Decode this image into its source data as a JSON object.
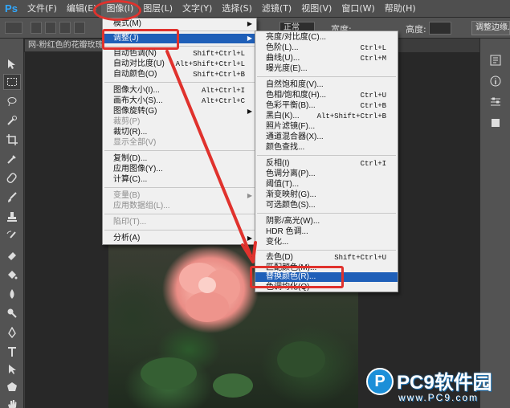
{
  "app": {
    "logo": "Ps",
    "menu": [
      {
        "label": "文件(F)"
      },
      {
        "label": "编辑(E)"
      },
      {
        "label": "图像(I)"
      },
      {
        "label": "图层(L)"
      },
      {
        "label": "文字(Y)"
      },
      {
        "label": "选择(S)"
      },
      {
        "label": "滤镜(T)"
      },
      {
        "label": "视图(V)"
      },
      {
        "label": "窗口(W)"
      },
      {
        "label": "帮助(H)"
      }
    ]
  },
  "options_bar": {
    "style_value": "正常",
    "width_label": "宽度:",
    "height_label": "高度:",
    "refine_button": "调整边缘..."
  },
  "document": {
    "tab_title": "网-粉红色的花瓣玫瑰"
  },
  "image_menu": {
    "items": [
      {
        "label": "模式(M)",
        "shortcut": "",
        "submenu": true,
        "disabled": false
      },
      {
        "label": "调整(J)",
        "shortcut": "",
        "submenu": true,
        "disabled": false
      },
      {
        "label": "自动色调(N)",
        "shortcut": "Shift+Ctrl+L",
        "submenu": false,
        "disabled": false
      },
      {
        "label": "自动对比度(U)",
        "shortcut": "Alt+Shift+Ctrl+L",
        "submenu": false,
        "disabled": false
      },
      {
        "label": "自动颜色(O)",
        "shortcut": "Shift+Ctrl+B",
        "submenu": false,
        "disabled": false
      },
      {
        "label": "图像大小(I)...",
        "shortcut": "Alt+Ctrl+I",
        "submenu": false,
        "disabled": false
      },
      {
        "label": "画布大小(S)...",
        "shortcut": "Alt+Ctrl+C",
        "submenu": false,
        "disabled": false
      },
      {
        "label": "图像旋转(G)",
        "shortcut": "",
        "submenu": true,
        "disabled": false
      },
      {
        "label": "裁剪(P)",
        "shortcut": "",
        "submenu": false,
        "disabled": true
      },
      {
        "label": "裁切(R)...",
        "shortcut": "",
        "submenu": false,
        "disabled": false
      },
      {
        "label": "显示全部(V)",
        "shortcut": "",
        "submenu": false,
        "disabled": true
      },
      {
        "label": "复制(D)...",
        "shortcut": "",
        "submenu": false,
        "disabled": false
      },
      {
        "label": "应用图像(Y)...",
        "shortcut": "",
        "submenu": false,
        "disabled": false
      },
      {
        "label": "计算(C)...",
        "shortcut": "",
        "submenu": false,
        "disabled": false
      },
      {
        "label": "变量(B)",
        "shortcut": "",
        "submenu": true,
        "disabled": true
      },
      {
        "label": "应用数据组(L)...",
        "shortcut": "",
        "submenu": false,
        "disabled": true
      },
      {
        "label": "陷印(T)...",
        "shortcut": "",
        "submenu": false,
        "disabled": true
      },
      {
        "label": "分析(A)",
        "shortcut": "",
        "submenu": true,
        "disabled": false
      }
    ]
  },
  "adjust_menu": {
    "items": [
      {
        "label": "亮度/对比度(C)...",
        "shortcut": ""
      },
      {
        "label": "色阶(L)...",
        "shortcut": "Ctrl+L"
      },
      {
        "label": "曲线(U)...",
        "shortcut": "Ctrl+M"
      },
      {
        "label": "曝光度(E)...",
        "shortcut": ""
      },
      {
        "label": "自然饱和度(V)...",
        "shortcut": ""
      },
      {
        "label": "色相/饱和度(H)...",
        "shortcut": "Ctrl+U"
      },
      {
        "label": "色彩平衡(B)...",
        "shortcut": "Ctrl+B"
      },
      {
        "label": "黑白(K)...",
        "shortcut": "Alt+Shift+Ctrl+B"
      },
      {
        "label": "照片滤镜(F)...",
        "shortcut": ""
      },
      {
        "label": "通道混合器(X)...",
        "shortcut": ""
      },
      {
        "label": "颜色查找...",
        "shortcut": ""
      },
      {
        "label": "反相(I)",
        "shortcut": "Ctrl+I"
      },
      {
        "label": "色调分离(P)...",
        "shortcut": ""
      },
      {
        "label": "阈值(T)...",
        "shortcut": ""
      },
      {
        "label": "渐变映射(G)...",
        "shortcut": ""
      },
      {
        "label": "可选颜色(S)...",
        "shortcut": ""
      },
      {
        "label": "阴影/高光(W)...",
        "shortcut": ""
      },
      {
        "label": "HDR 色调...",
        "shortcut": ""
      },
      {
        "label": "变化...",
        "shortcut": ""
      },
      {
        "label": "去色(D)",
        "shortcut": "Shift+Ctrl+U"
      },
      {
        "label": "匹配颜色(M)...",
        "shortcut": ""
      },
      {
        "label": "替换颜色(R)...",
        "shortcut": ""
      },
      {
        "label": "色调均化(Q)",
        "shortcut": ""
      }
    ]
  },
  "watermark": {
    "logo": "P",
    "title": "PC9软件园",
    "url": "www.PC9.com"
  },
  "colors": {
    "menu_highlight": "#1f5fb8",
    "annotation_red": "#e0322d",
    "watermark_blue": "#1c8fd8"
  }
}
